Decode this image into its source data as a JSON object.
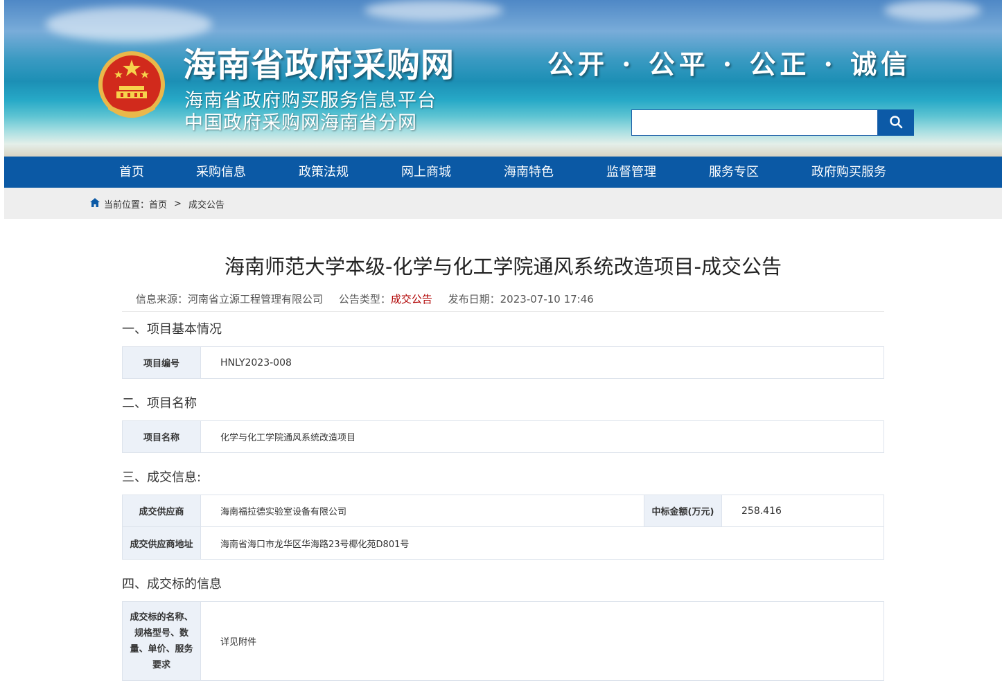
{
  "banner": {
    "title": "海南省政府采购网",
    "subtitle1": "海南省政府购买服务信息平台",
    "subtitle2": "中国政府采购网海南省分网",
    "slogan": "公开 · 公平 · 公正 · 诚信",
    "search_placeholder": ""
  },
  "nav": {
    "items": [
      {
        "label": "首页"
      },
      {
        "label": "采购信息"
      },
      {
        "label": "政策法规"
      },
      {
        "label": "网上商城"
      },
      {
        "label": "海南特色"
      },
      {
        "label": "监督管理"
      },
      {
        "label": "服务专区"
      },
      {
        "label": "政府购买服务"
      }
    ]
  },
  "breadcrumb": {
    "prefix": "当前位置：",
    "home": "首页",
    "separator": ">",
    "current": "成交公告"
  },
  "article": {
    "title": "海南师范大学本级-化学与化工学院通风系统改造项目-成交公告",
    "source_label": "信息来源：",
    "source_value": "河南省立源工程管理有限公司",
    "type_label": "公告类型：",
    "type_value": "成交公告",
    "date_label": "发布日期：",
    "date_value": "2023-07-10 17:46"
  },
  "sections": {
    "s1": {
      "heading": "一、项目基本情况",
      "label": "项目编号",
      "value": "HNLY2023-008"
    },
    "s2": {
      "heading": "二、项目名称",
      "label": "项目名称",
      "value": "化学与化工学院通风系统改造项目"
    },
    "s3": {
      "heading": "三、成交信息:",
      "supplier_label": "成交供应商",
      "supplier_value": "海南福拉德实验室设备有限公司",
      "amount_label": "中标金额(万元)",
      "amount_value": "258.416",
      "address_label": "成交供应商地址",
      "address_value": "海南省海口市龙华区华海路23号椰化苑D801号"
    },
    "s4": {
      "heading": "四、成交标的信息",
      "label": "成交标的名称、规格型号、数量、单价、服务要求",
      "value": "详见附件"
    }
  },
  "colors": {
    "nav_bg": "#0b59a5",
    "crumb_bg": "#eeeeee",
    "table_header_bg": "#ecf1f8",
    "type_red": "#b00000"
  }
}
